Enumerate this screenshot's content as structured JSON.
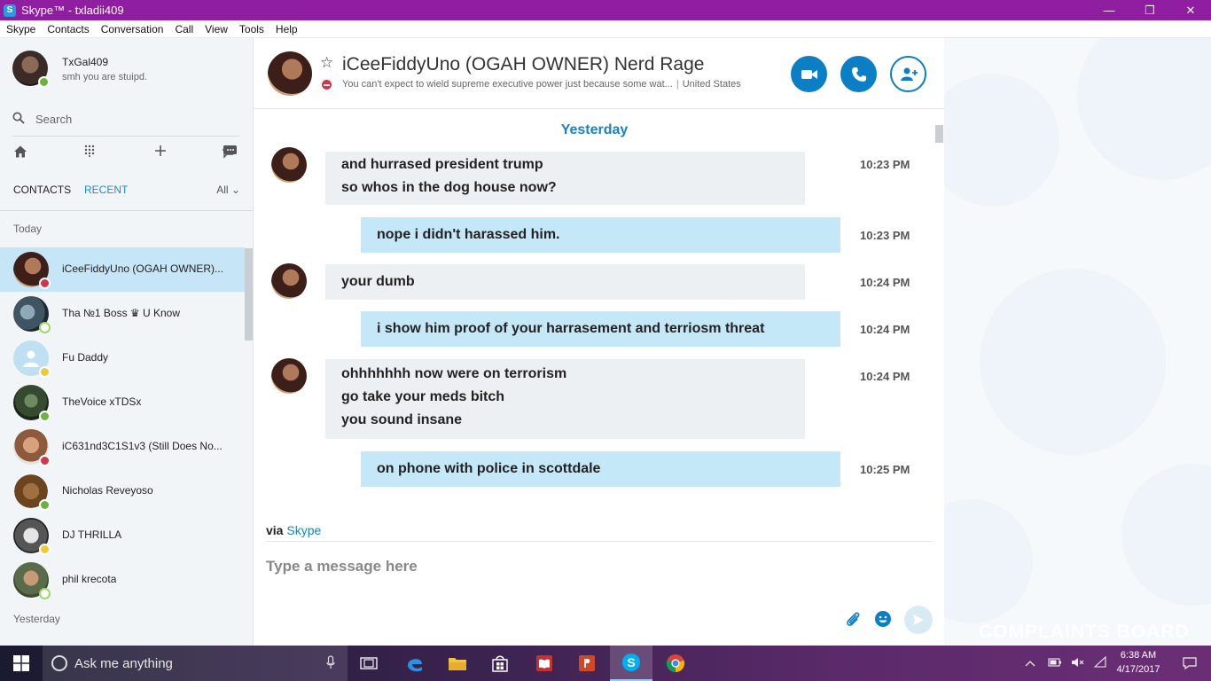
{
  "window": {
    "title": "Skype™ - txladii409",
    "minimize_glyph": "—",
    "restore_glyph": "❐",
    "close_glyph": "✕"
  },
  "menu": [
    "Skype",
    "Contacts",
    "Conversation",
    "Call",
    "View",
    "Tools",
    "Help"
  ],
  "profile": {
    "name": "TxGal409",
    "mood": "smh you are stuipd."
  },
  "search": {
    "placeholder": "Search"
  },
  "tabs": {
    "contacts": "CONTACTS",
    "recent": "RECENT",
    "filter": "All ⌄"
  },
  "groups": {
    "today": "Today",
    "yesterday": "Yesterday"
  },
  "contacts": [
    {
      "name": "iCeeFiddyUno (OGAH OWNER)...",
      "status": "busy",
      "selected": true
    },
    {
      "name": "Tha №1 Boss ♛ U Know",
      "status": "offline"
    },
    {
      "name": "Fu Daddy",
      "status": "away"
    },
    {
      "name": "TheVoice xTDSx",
      "status": "online"
    },
    {
      "name": "iC631nd3C1S1v3 (Still Does No...",
      "status": "busy"
    },
    {
      "name": "Nicholas Reveyoso",
      "status": "online"
    },
    {
      "name": "DJ THRILLA",
      "status": "away"
    },
    {
      "name": "phil krecota",
      "status": "offline"
    }
  ],
  "conversation": {
    "name": "iCeeFiddyUno (OGAH OWNER) Nerd Rage",
    "mood": "You can't expect to wield supreme executive power just because some wat...",
    "location": "United States",
    "day_label": "Yesterday",
    "messages": [
      {
        "direction": "in",
        "lines": [
          "and hurrased president trump",
          "so whos in the dog house now?"
        ],
        "time": "10:23 PM"
      },
      {
        "direction": "out",
        "lines": [
          "nope  i didn't harassed him."
        ],
        "time": "10:23 PM"
      },
      {
        "direction": "in",
        "lines": [
          "your dumb"
        ],
        "time": "10:24 PM"
      },
      {
        "direction": "out",
        "lines": [
          "i show him proof of your harrasement and terriosm threat"
        ],
        "time": "10:24 PM"
      },
      {
        "direction": "in",
        "lines": [
          "ohhhhhhh now were on terrorism",
          "go take your meds bitch",
          "you sound insane"
        ],
        "time": "10:24 PM"
      },
      {
        "direction": "out",
        "lines": [
          "on phone with police in scottdale"
        ],
        "time": "10:25 PM"
      }
    ],
    "via_label": "via",
    "via_link": "Skype",
    "compose_placeholder": "Type a message here"
  },
  "taskbar": {
    "search_placeholder": "Ask me anything",
    "clock_time": "6:38 AM",
    "clock_date": "4/17/2017",
    "watermark": "COMPLAINTS BOARD"
  },
  "colors": {
    "titlebar": "#8f1ea0",
    "accent": "#1a82c4",
    "busy": "#d1344b",
    "online": "#6cb33e",
    "away": "#f4c73b",
    "bubble_in": "#edf0f2",
    "bubble_out": "#c5e8f8"
  },
  "icons": {
    "hdr_buttons": [
      "video-call-icon",
      "audio-call-icon",
      "add-people-icon"
    ],
    "nav": [
      "home-icon",
      "dialpad-icon",
      "add-icon",
      "chat-icon"
    ],
    "taskbar_apps": [
      "task-view-icon",
      "edge-icon",
      "file-explorer-icon",
      "store-icon",
      "reader-icon",
      "powerpoint-icon",
      "skype-icon",
      "chrome-icon"
    ]
  }
}
